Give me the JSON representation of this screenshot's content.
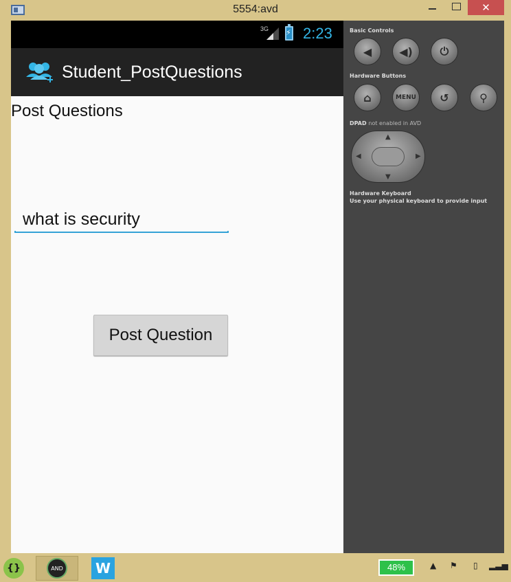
{
  "window": {
    "title": "5554:avd"
  },
  "device": {
    "status": {
      "network": "3G",
      "time": "2:23"
    },
    "actionbar": {
      "title": "Student_PostQuestions"
    },
    "content": {
      "heading": "Post Questions",
      "question_value": "what is security",
      "post_button_label": "Post Question"
    }
  },
  "panel": {
    "basic_controls_label": "Basic Controls",
    "hardware_buttons_label": "Hardware Buttons",
    "menu_label": "MENU",
    "dpad_label": "DPAD",
    "dpad_note": "not enabled in AVD",
    "keyboard_label": "Hardware Keyboard",
    "keyboard_note": "Use your physical keyboard to provide input"
  },
  "taskbar": {
    "battery_percent": "48%",
    "avd_label": "AND"
  },
  "colors": {
    "accent_blue": "#33b5e5",
    "battery_green": "#2ec14a",
    "close_red": "#c75050"
  }
}
